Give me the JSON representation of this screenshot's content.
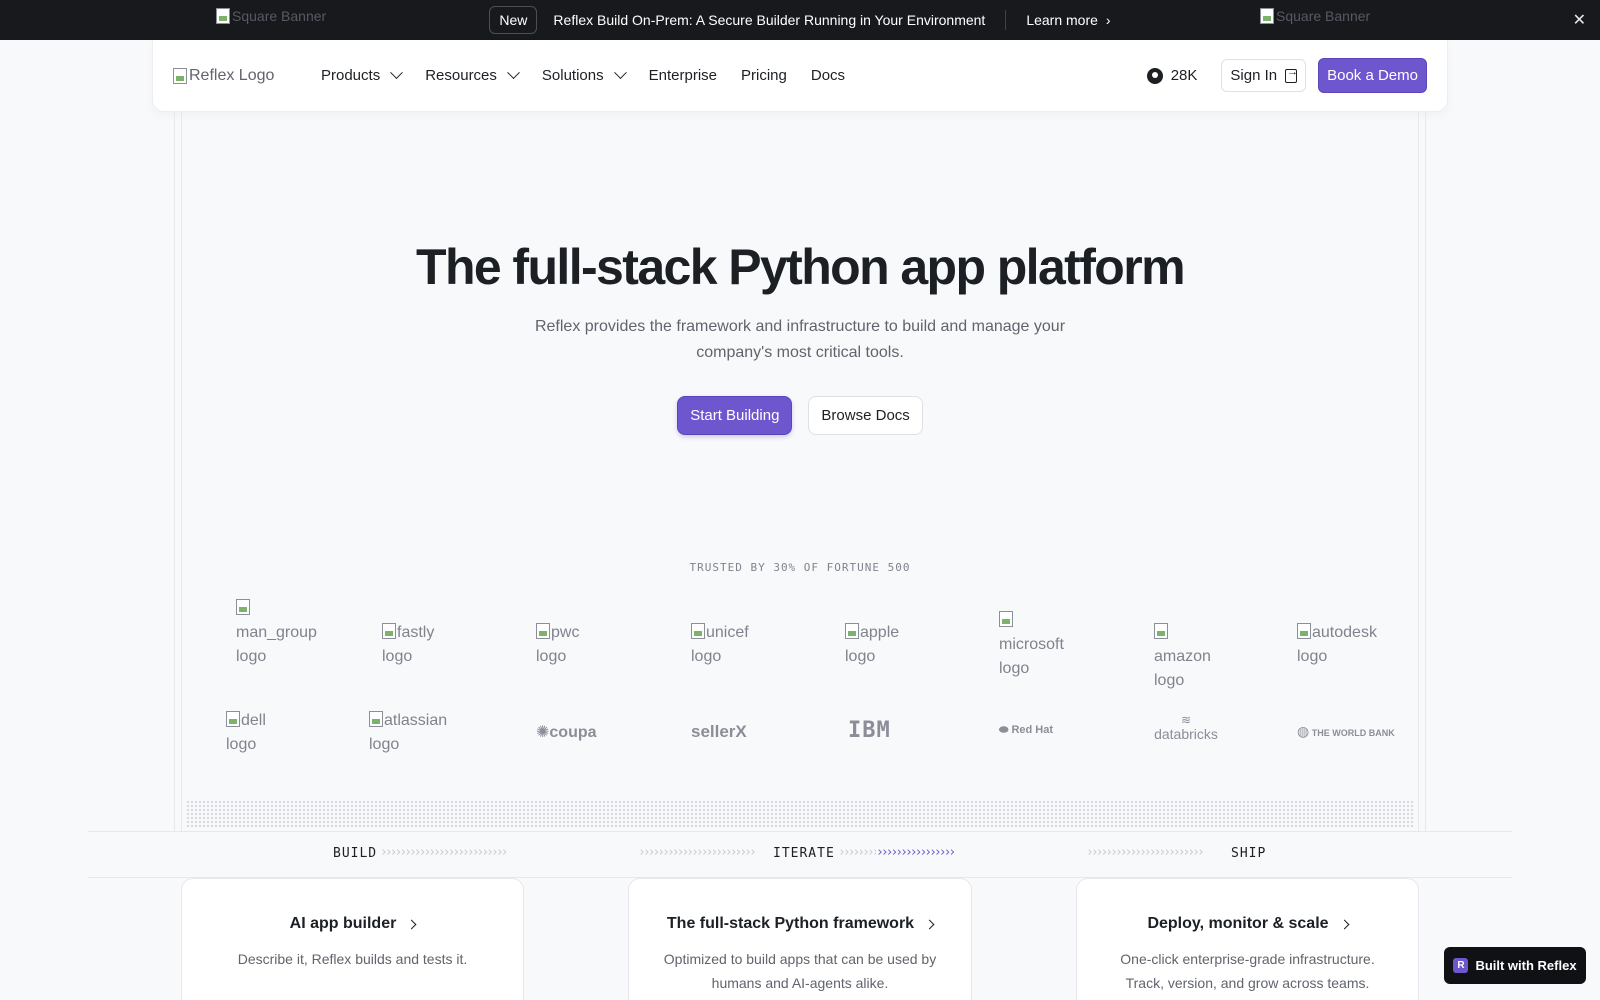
{
  "announcement": {
    "banner_left_alt": "Square Banner",
    "banner_right_alt": "Square Banner",
    "badge": "New",
    "message": "Reflex Build On-Prem: A Secure Builder Running in Your Environment",
    "link": "Learn more",
    "close_icon": "close-icon"
  },
  "nav": {
    "logo_alt": "Reflex Logo",
    "links": [
      "Products",
      "Resources",
      "Solutions",
      "Enterprise",
      "Pricing",
      "Docs"
    ],
    "github_stars": "28K",
    "signin": "Sign In",
    "demo": "Book a Demo"
  },
  "hero": {
    "title": "The full-stack Python app platform",
    "subtitle": "Reflex provides the framework and infrastructure to build and manage your company's most critical tools.",
    "primary_button": "Start Building",
    "secondary_button": "Browse Docs"
  },
  "trusted": {
    "heading": "TRUSTED BY 30% OF FORTUNE 500",
    "row1": [
      "man_group logo",
      "fastly logo",
      "pwc logo",
      "unicef logo",
      "apple logo",
      "microsoft logo",
      "amazon logo",
      "autodesk logo"
    ],
    "row2_broken": [
      "dell logo",
      "atlassian logo"
    ],
    "row2_brands": [
      "coupa",
      "sellerX",
      "IBM",
      "Red Hat",
      "databricks",
      "THE WORLD BANK"
    ]
  },
  "pipeline": {
    "stages": [
      "BUILD",
      "ITERATE",
      "SHIP"
    ],
    "cards": [
      {
        "title": "AI app builder",
        "desc": "Describe it, Reflex builds and tests it."
      },
      {
        "title": "The full-stack Python framework",
        "desc": "Optimized to build apps that can be used by humans and AI-agents alike."
      },
      {
        "title": "Deploy, monitor & scale",
        "desc": "One-click enterprise-grade infrastructure. Track, version, and grow across teams."
      }
    ]
  },
  "built_with": "Built with Reflex",
  "colors": {
    "accent": "#6e56cf",
    "banner_bg": "#17191d",
    "page_bg": "#f8f9fb"
  }
}
